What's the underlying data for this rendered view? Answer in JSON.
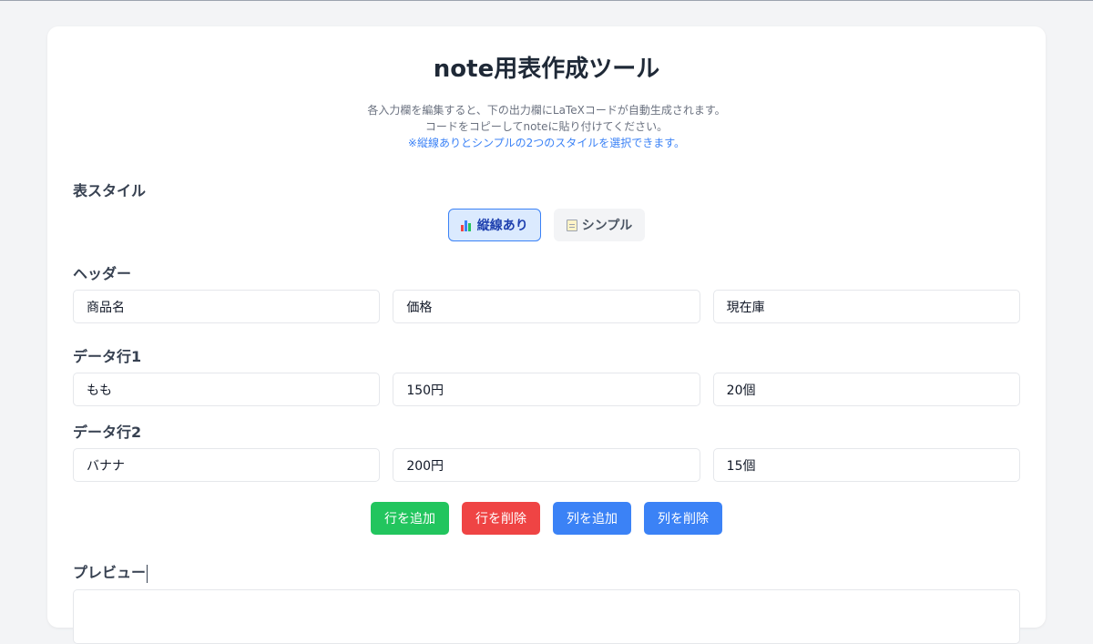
{
  "title": "note用表作成ツール",
  "description": {
    "line1": "各入力欄を編集すると、下の出力欄にLaTeXコードが自動生成されます。",
    "line2": "コードをコピーしてnoteに貼り付けてください。",
    "line3": "※縦線ありとシンプルの2つのスタイルを選択できます。"
  },
  "style_section": {
    "label": "表スタイル",
    "options": [
      {
        "label": "縦線あり",
        "icon": "bar-chart-icon",
        "active": true
      },
      {
        "label": "シンプル",
        "icon": "memo-icon",
        "active": false
      }
    ]
  },
  "header": {
    "label": "ヘッダー",
    "cells": [
      "商品名",
      "価格",
      "現在庫"
    ]
  },
  "rows": [
    {
      "label": "データ行1",
      "cells": [
        "もも",
        "150円",
        "20個"
      ]
    },
    {
      "label": "データ行2",
      "cells": [
        "バナナ",
        "200円",
        "15個"
      ]
    }
  ],
  "actions": {
    "add_row": "行を追加",
    "delete_row": "行を削除",
    "add_column": "列を追加",
    "delete_column": "列を削除"
  },
  "preview": {
    "label": "プレビュー"
  },
  "colors": {
    "accent": "#3b82f6",
    "success": "#22c55e",
    "danger": "#ef4444"
  }
}
